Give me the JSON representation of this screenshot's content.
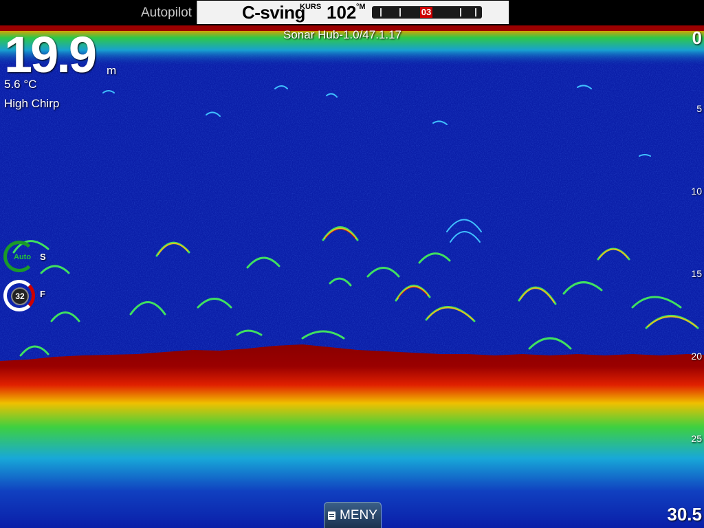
{
  "autopilot": {
    "label": "Autopilot",
    "mode": "C-sving",
    "heading_label": "KURS",
    "heading": "102",
    "heading_unit": "°M",
    "rudder_value": "03"
  },
  "sonar": {
    "source": "Sonar Hub-1.0/47.1.17",
    "depth": "19.9",
    "depth_unit": "m",
    "water_temp": "5.6 °C",
    "frequency": "High Chirp",
    "scale": [
      "0",
      "5",
      "10",
      "15",
      "20",
      "25"
    ],
    "range": "30.5"
  },
  "controls": {
    "auto_label": "Auto",
    "auto_suffix": "S",
    "gain_value": "32",
    "gain_suffix": "F"
  },
  "menu": {
    "label": "MENY"
  },
  "colors": {
    "water": "#0a1ea8",
    "bottom": "#8b0000",
    "autopilot_panel": "#f2f2f2",
    "rudder_indicator": "#cc0000",
    "auto_ring": "#1a9a2a"
  },
  "icons": {
    "menu": "menu-icon"
  }
}
